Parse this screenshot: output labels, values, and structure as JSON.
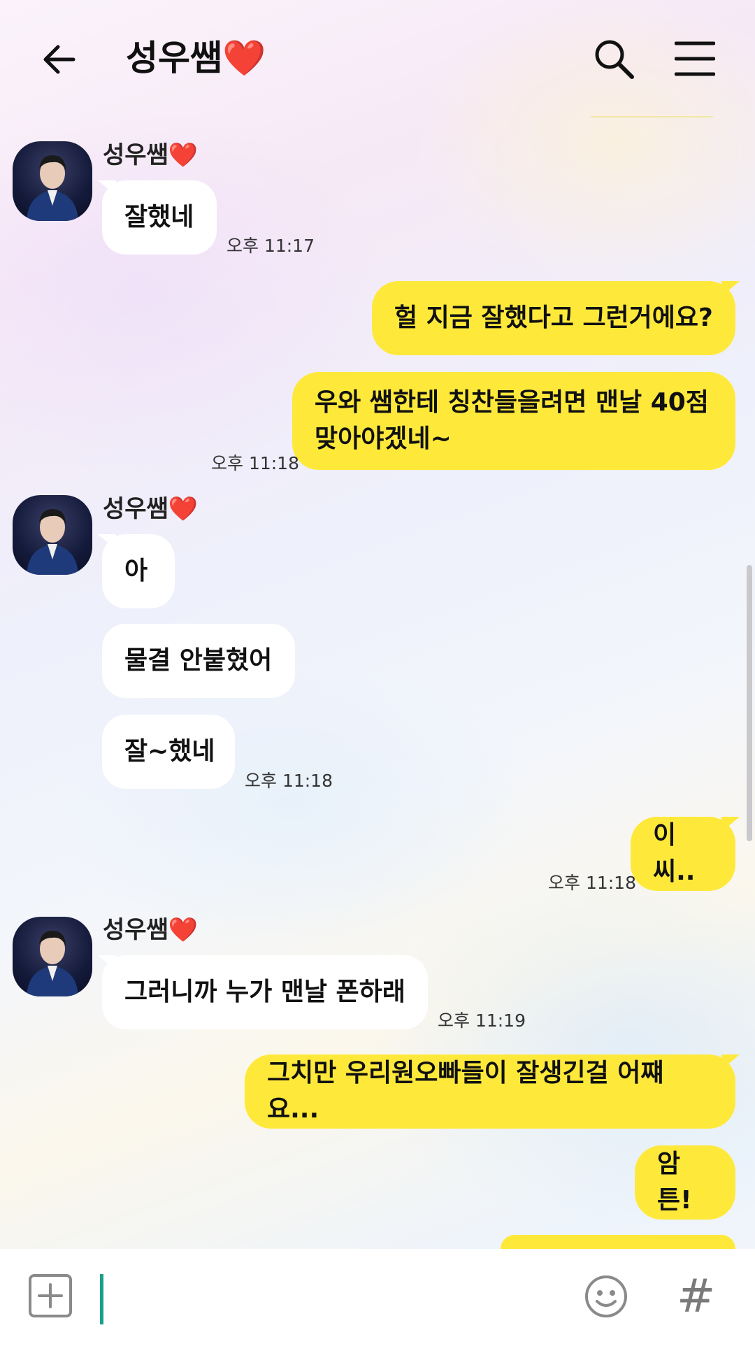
{
  "header": {
    "title": "성우쌤❤️",
    "back_icon": "back-arrow-icon",
    "search_icon": "search-icon",
    "menu_icon": "hamburger-menu-icon"
  },
  "colors": {
    "outgoing_bubble": "#fee93a",
    "incoming_bubble": "#ffffff",
    "cursor": "#1aa08b"
  },
  "messages": {
    "g1": {
      "sender": "성우쌤❤️",
      "m1": "잘했네",
      "time": "오후 11:17"
    },
    "o1": {
      "m1": "헐 지금 잘했다고 그런거에요?",
      "m2_line1": "우와 쌤한테 칭찬들을려면 맨날 40점",
      "m2_line2": "맞아야겠네~",
      "time": "오후 11:18"
    },
    "g2": {
      "sender": "성우쌤❤️",
      "m1": "아",
      "m2": "물결 안붙혔어",
      "m3": "잘~했네",
      "time": "오후 11:18"
    },
    "o2": {
      "m1": "이씨..",
      "time": "오후 11:18"
    },
    "g3": {
      "sender": "성우쌤❤️",
      "m1": "그러니까 누가 맨날 폰하래",
      "time": "오후 11:19"
    },
    "o3": {
      "m1": "그치만 우리원오빠들이 잘생긴걸 어쨰요...",
      "m2": "암튼!"
    }
  },
  "input_bar": {
    "plus_icon": "plus-square-icon",
    "emoji_icon": "emoji-smile-icon",
    "hash_label": "#"
  }
}
